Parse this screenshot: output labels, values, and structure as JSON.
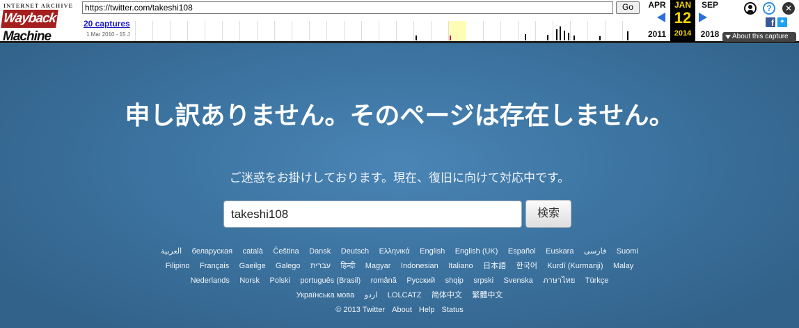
{
  "wayback": {
    "logo_top": "INTERNET ARCHIVE",
    "logo_part1": "Wayback",
    "logo_part2": "Machine",
    "url": "https://twitter.com/takeshi108",
    "go_label": "Go",
    "captures_label": "20 captures",
    "captures_range": "1 Mar 2010 - 15 J",
    "calendar": {
      "prev": {
        "month": "APR",
        "year": "2011"
      },
      "current": {
        "month": "JAN",
        "day": "12",
        "year": "2014"
      },
      "next": {
        "month": "SEP",
        "year": "2018"
      }
    },
    "about_label": "About this capture",
    "colors": {
      "highlight": "#fffcb5",
      "current_bar": "#c0185b",
      "accent": "#2a6fdb"
    },
    "sparkline": {
      "current_index": 1,
      "bars": [
        {
          "year_index": 0,
          "level": 0
        },
        {
          "year_index": 13.1,
          "level": 0.65
        },
        {
          "year_index": 14.05,
          "level": 0.35
        },
        {
          "year_index": 20.3,
          "level": 0.45
        },
        {
          "year_index": 21.6,
          "level": 0.4
        },
        {
          "year_index": 22.1,
          "level": 0.8
        },
        {
          "year_index": 22.3,
          "level": 1.0
        },
        {
          "year_index": 22.55,
          "level": 0.7
        },
        {
          "year_index": 22.8,
          "level": 0.55
        },
        {
          "year_index": 23.1,
          "level": 0.35
        },
        {
          "year_index": 24.6,
          "level": 0.3
        },
        {
          "year_index": 26.2,
          "level": 0.65
        }
      ]
    }
  },
  "page": {
    "title": "申し訳ありません。そのページは存在しません。",
    "subtitle": "ご迷惑をお掛けしております。現在、復旧に向けて対応中です。",
    "search_value": "takeshi108",
    "search_button": "検索",
    "languages": [
      "العربية",
      "беларуская",
      "català",
      "Čeština",
      "Dansk",
      "Deutsch",
      "Ελληνικά",
      "English",
      "English (UK)",
      "Español",
      "Euskara",
      "فارسی",
      "Suomi",
      "Filipino",
      "Français",
      "Gaeilge",
      "Galego",
      "עברית",
      "हिन्दी",
      "Magyar",
      "Indonesian",
      "Italiano",
      "日本語",
      "한국어",
      "Kurdî (Kurmanji)",
      "Malay",
      "Nederlands",
      "Norsk",
      "Polski",
      "português (Brasil)",
      "română",
      "Русский",
      "shqip",
      "srpski",
      "Svenska",
      "ภาษาไทย",
      "Türkçe",
      "Українська мова",
      "اردو",
      "LOLCATZ",
      "简体中文",
      "繁體中文"
    ],
    "footer": [
      "© 2013 Twitter",
      "About",
      "Help",
      "Status"
    ]
  }
}
